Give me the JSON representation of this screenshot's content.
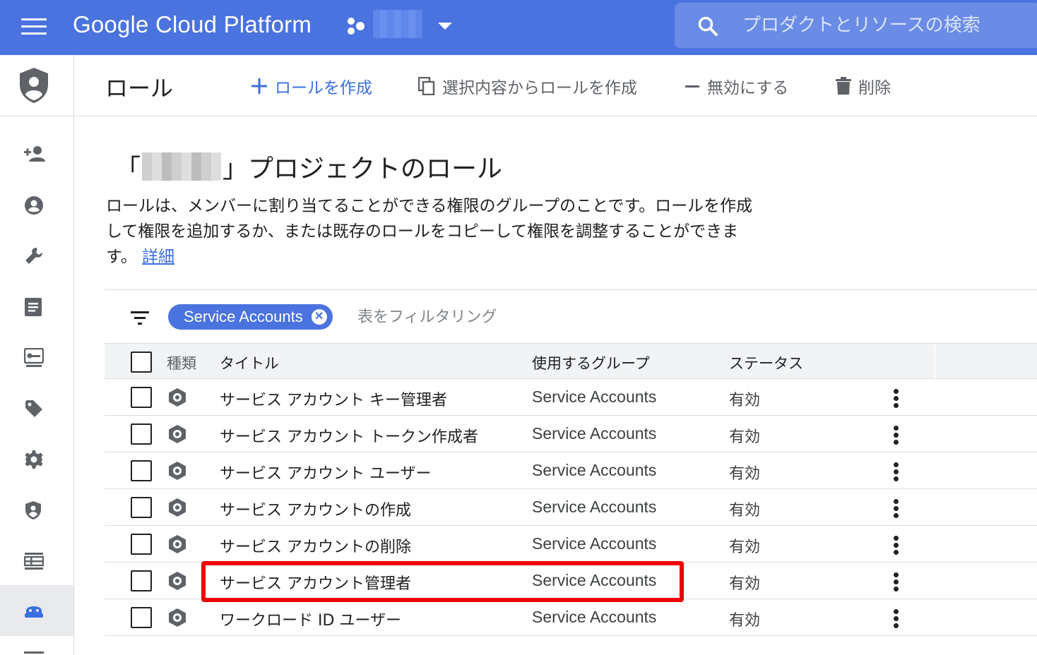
{
  "topbar": {
    "brand": "Google Cloud Platform",
    "search_placeholder": "プロダクトとリソースの検索"
  },
  "rail": {
    "items": [
      "add-member-icon",
      "account-circle-icon",
      "wrench-icon",
      "document-icon",
      "key-icon",
      "tag-icon",
      "gear-icon",
      "shield-icon",
      "table-icon",
      "roles-icon"
    ]
  },
  "actionbar": {
    "title": "ロール",
    "create": "ロールを作成",
    "create_from_selection": "選択内容からロールを作成",
    "disable": "無効にする",
    "delete": "削除"
  },
  "heading": {
    "open_quote": "「",
    "close_text": "」プロジェクトのロール"
  },
  "description": {
    "text": "ロールは、メンバーに割り当てることができる権限のグループのことです。ロールを作成して権限を追加するか、または既存のロールをコピーして権限を調整することができます。",
    "link": "詳細"
  },
  "filter": {
    "chip": "Service Accounts",
    "placeholder": "表をフィルタリング"
  },
  "table": {
    "headers": {
      "kind": "種類",
      "title": "タイトル",
      "group": "使用するグループ",
      "status": "ステータス"
    },
    "rows": [
      {
        "title": "サービス アカウント キー管理者",
        "group": "Service Accounts",
        "status": "有効"
      },
      {
        "title": "サービス アカウント トークン作成者",
        "group": "Service Accounts",
        "status": "有効"
      },
      {
        "title": "サービス アカウント ユーザー",
        "group": "Service Accounts",
        "status": "有効"
      },
      {
        "title": "サービス アカウントの作成",
        "group": "Service Accounts",
        "status": "有効"
      },
      {
        "title": "サービス アカウントの削除",
        "group": "Service Accounts",
        "status": "有効"
      },
      {
        "title": "サービス アカウント管理者",
        "group": "Service Accounts",
        "status": "有効"
      },
      {
        "title": "ワークロード ID ユーザー",
        "group": "Service Accounts",
        "status": "有効"
      }
    ]
  },
  "colors": {
    "brand_blue": "#4a73df",
    "link_blue": "#3b6fe0",
    "highlight_red": "#f00000"
  }
}
